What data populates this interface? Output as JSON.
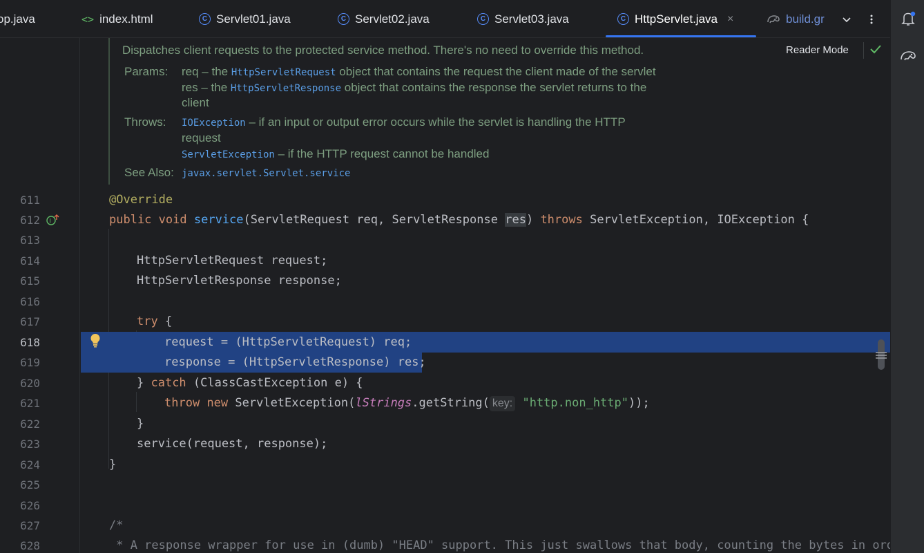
{
  "tabs": [
    {
      "label": "op.java",
      "icon": "java-class-icon"
    },
    {
      "label": "index.html",
      "icon": "html-file-icon"
    },
    {
      "label": "Servlet01.java",
      "icon": "java-class-icon"
    },
    {
      "label": "Servlet02.java",
      "icon": "java-class-icon"
    },
    {
      "label": "Servlet03.java",
      "icon": "java-class-icon"
    },
    {
      "label": "HttpServlet.java",
      "icon": "java-class-icon",
      "active": true
    },
    {
      "label": "build.gr",
      "icon": "gradle-icon"
    }
  ],
  "tab_close": "×",
  "doc": {
    "summary": "Dispatches client requests to the protected service method. There's no need to override this method.",
    "params_label": "Params:",
    "param1_name": "req",
    "param1_dash": " – the ",
    "param1_type": "HttpServletRequest",
    "param1_rest": " object that contains the request the client made of the servlet",
    "param2_name": "res",
    "param2_dash": " – the ",
    "param2_type": "HttpServletResponse",
    "param2_rest": " object that contains the response the servlet returns to the",
    "param2_cont": "client",
    "throws_label": "Throws:",
    "throw1_type": "IOException",
    "throw1_rest": " – if an input or output error occurs while the servlet is handling the HTTP",
    "throw1_cont": "request",
    "throw2_type": "ServletException",
    "throw2_rest": " – if the HTTP request cannot be handled",
    "see_label": "See Also:",
    "see_link": "javax.servlet.Servlet.service",
    "reader_mode": "Reader Mode"
  },
  "line_numbers": [
    "611",
    "612",
    "613",
    "614",
    "615",
    "616",
    "617",
    "618",
    "619",
    "620",
    "621",
    "622",
    "623",
    "624",
    "625",
    "626",
    "627",
    "628"
  ],
  "code": {
    "l611": "@Override",
    "l612_kw1": "public",
    "l612_kw2": "void",
    "l612_fn": "service",
    "l612_a": "(ServletRequest req, ServletResponse ",
    "l612_res": "res",
    "l612_b": ") ",
    "l612_kw3": "throws",
    "l612_c": " ServletException, IOException {",
    "l614": "HttpServletRequest request;",
    "l615": "HttpServletResponse response;",
    "l617_kw": "try",
    "l617_b": " {",
    "l618": "request = (HttpServletRequest) req;",
    "l619": "response = (HttpServletResponse) res;",
    "l620_a": "} ",
    "l620_kw": "catch",
    "l620_b": " (ClassCastException e) {",
    "l621_kw1": "throw",
    "l621_kw2": "new",
    "l621_a": " ServletException(",
    "l621_stat": "lStrings",
    "l621_b": ".getString(",
    "l621_hint": "key:",
    "l621_str": "\"http.non_http\"",
    "l621_c": "));",
    "l622": "}",
    "l623": "service(request, response);",
    "l624": "}",
    "l627": "/*",
    "l628": " * A response wrapper for use in (dumb) \"HEAD\" support. This just swallows that body, counting the bytes in order"
  },
  "colors": {
    "selection": "#214283",
    "keyword": "#cf8e6d",
    "function": "#56a8f5",
    "annotation": "#b3ae60",
    "string": "#6aab73",
    "accent": "#3574f0"
  }
}
